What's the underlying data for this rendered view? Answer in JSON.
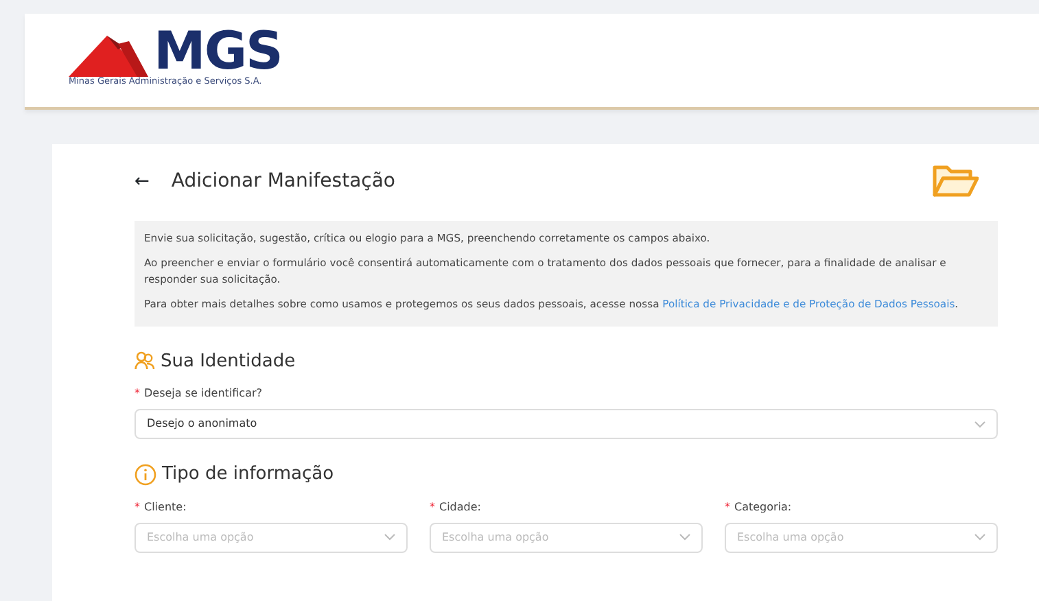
{
  "header": {
    "logo_text": "MGS",
    "logo_subtitle": "Minas Gerais Administração e Serviços S.A."
  },
  "page": {
    "back": "←",
    "title": "Adicionar Manifestação"
  },
  "notice": {
    "paragraphs": [
      "Envie sua solicitação, sugestão, crítica ou elogio para a MGS, preenchendo corretamente os campos abaixo.",
      "Ao preencher e enviar o formulário você consentirá automaticamente com o tratamento dos dados pessoais que fornecer, para a finalidade de analisar e responder sua solicitação."
    ],
    "link_intro": "Para obter mais detalhes sobre como usamos e protegemos os seus dados pessoais, acesse nossa ",
    "link": "Política de Privacidade e de Proteção de Dados Pessoais",
    "link_end": "."
  },
  "sections": [
    {
      "kind": "identity",
      "title": "Sua Identidade",
      "fields": [
        {
          "required_mark": "*",
          "label": "Deseja se identificar?",
          "value": "Desejo o anonimato"
        }
      ]
    },
    {
      "kind": "info",
      "title": "Tipo de informação",
      "fields": [
        {
          "required_mark": "*",
          "label": "Cliente:",
          "placeholder": "Escolha uma opção"
        },
        {
          "required_mark": "*",
          "label": "Cidade:",
          "placeholder": "Escolha uma opção"
        },
        {
          "required_mark": "*",
          "label": "Categoria:",
          "placeholder": "Escolha uma opção"
        }
      ]
    }
  ]
}
